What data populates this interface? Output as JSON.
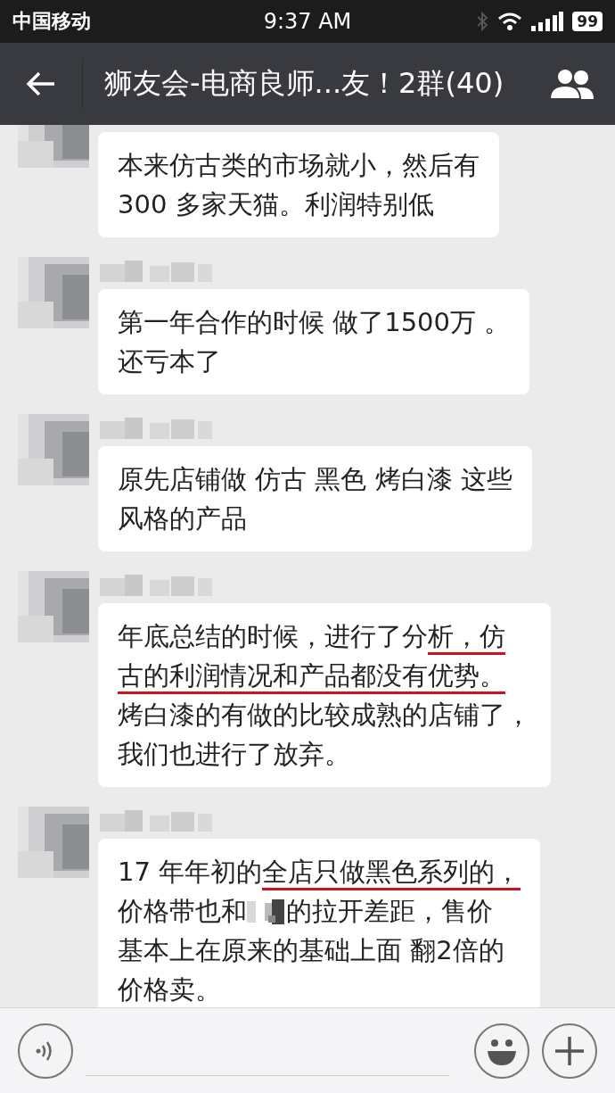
{
  "status_bar": {
    "carrier": "中国移动",
    "time": "9:37 AM",
    "battery": "99"
  },
  "nav_bar": {
    "title": "狮友会-电商良师...友！2群(40)"
  },
  "messages": [
    {
      "show_sender": false,
      "lines": [
        [
          {
            "kind": "text",
            "text": "本来仿古类的市场就小，然后有",
            "underlined": false
          }
        ],
        [
          {
            "kind": "text",
            "text": "300 多家天猫。利润特别低",
            "underlined": false
          }
        ]
      ]
    },
    {
      "show_sender": true,
      "lines": [
        [
          {
            "kind": "text",
            "text": "第一年合作的时候 做了1500万 。",
            "underlined": false
          }
        ],
        [
          {
            "kind": "text",
            "text": "还亏本了",
            "underlined": false
          }
        ]
      ]
    },
    {
      "show_sender": true,
      "lines": [
        [
          {
            "kind": "text",
            "text": "原先店铺做 仿古 黑色 烤白漆 这些",
            "underlined": false
          }
        ],
        [
          {
            "kind": "text",
            "text": "风格的产品",
            "underlined": false
          }
        ]
      ]
    },
    {
      "show_sender": true,
      "lines": [
        [
          {
            "kind": "text",
            "text": "年底总结的时候，进行了分",
            "underlined": false
          },
          {
            "kind": "text",
            "text": "析，仿",
            "underlined": true
          }
        ],
        [
          {
            "kind": "text",
            "text": "古的利润情况和产品都没有优势。",
            "underlined": true
          }
        ],
        [
          {
            "kind": "text",
            "text": "烤白漆的有做的比较成熟的店铺了，",
            "underlined": false
          }
        ],
        [
          {
            "kind": "text",
            "text": "我们也进行了放弃。",
            "underlined": false
          }
        ]
      ]
    },
    {
      "show_sender": true,
      "lines": [
        [
          {
            "kind": "text",
            "text": "17 年年初的",
            "underlined": false
          },
          {
            "kind": "text",
            "text": "全店只做黑色系列的，",
            "underlined": true
          }
        ],
        [
          {
            "kind": "text",
            "text": "价格带也和",
            "underlined": false
          },
          {
            "kind": "redacted"
          },
          {
            "kind": "text",
            "text": "的拉开差距，售价",
            "underlined": false
          }
        ],
        [
          {
            "kind": "text",
            "text": "基本上在原来的基础上面 翻2倍的",
            "underlined": false
          }
        ],
        [
          {
            "kind": "text",
            "text": "价格卖。",
            "underlined": false
          }
        ]
      ]
    }
  ]
}
